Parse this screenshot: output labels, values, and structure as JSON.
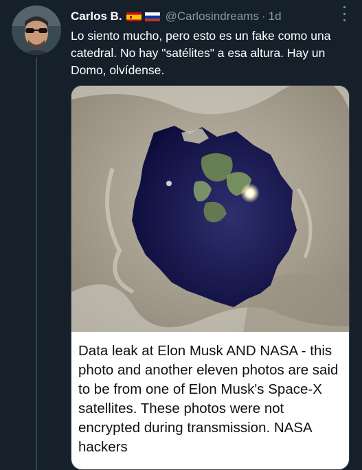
{
  "tweet": {
    "display_name": "Carlos B.",
    "flags": [
      "spain-flag",
      "russia-flag"
    ],
    "handle": "@Carlosindreams",
    "separator": "·",
    "time": "1d",
    "more_icon": "more-options-icon",
    "text": "Lo siento mucho, pero esto es un fake como una catedral. No hay \"satélites\" a esa altura. Hay un Domo, olvídense."
  },
  "media": {
    "image_icon": "flat-earth-dome-photo",
    "caption": "Data leak at Elon Musk AND NASA - this photo and another eleven photos are said to be from one of Elon Musk's Space-X satellites. These photos were not encrypted during transmission. NASA hackers"
  },
  "colors": {
    "background": "#15202b",
    "secondary_text": "#8899a6",
    "thread_line": "#38444d",
    "caption_text": "#111111"
  }
}
